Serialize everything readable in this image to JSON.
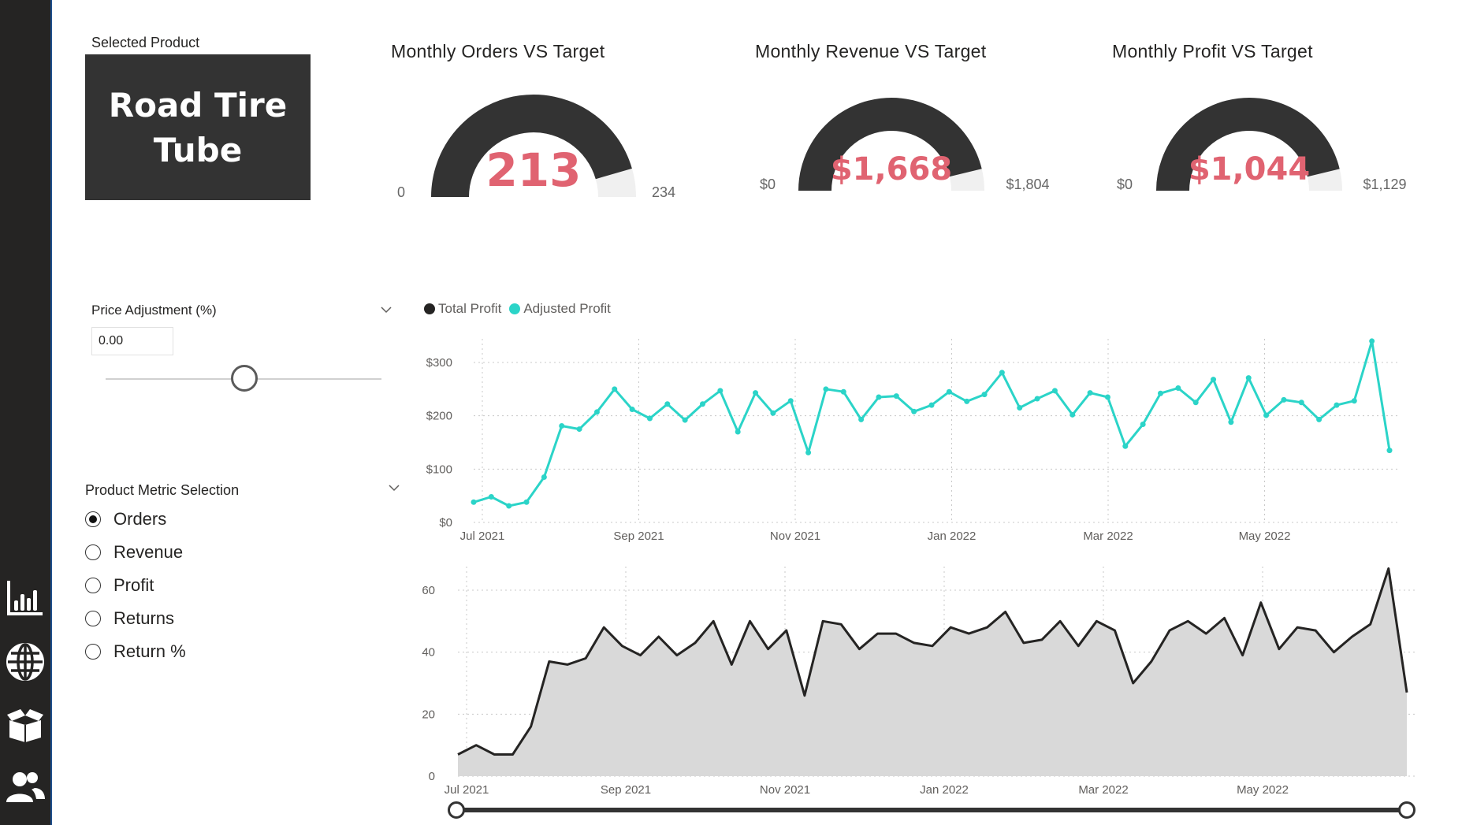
{
  "nav": {
    "items": [
      {
        "icon": "bar-chart-icon"
      },
      {
        "icon": "globe-icon"
      },
      {
        "icon": "open-box-icon"
      },
      {
        "icon": "users-icon"
      }
    ]
  },
  "product": {
    "label": "Selected Product",
    "name_line1": "Road Tire",
    "name_line2": "Tube"
  },
  "gauges": [
    {
      "title": "Monthly Orders VS Target",
      "value_text": "213",
      "min_text": "0",
      "max_text": "234",
      "fraction": 0.9103
    },
    {
      "title": "Monthly Revenue VS Target",
      "value_text": "$1,668",
      "min_text": "$0",
      "max_text": "$1,804",
      "fraction": 0.9246
    },
    {
      "title": "Monthly Profit VS Target",
      "value_text": "$1,044",
      "min_text": "$0",
      "max_text": "$1,129",
      "fraction": 0.9247
    }
  ],
  "colors": {
    "gauge_fill": "#333333",
    "gauge_empty": "#f0f0f0",
    "value": "#e06371",
    "adjusted": "#2bd4c8",
    "total": "#252423",
    "area": "#d9d9d9"
  },
  "price_adjustment": {
    "title": "Price Adjustment (%)",
    "value": "0.00",
    "slider_fraction": 0.5
  },
  "metric_selection": {
    "title": "Product Metric Selection",
    "options": [
      "Orders",
      "Revenue",
      "Profit",
      "Returns",
      "Return %"
    ],
    "selected": "Orders"
  },
  "legend": {
    "total": "Total Profit",
    "adjusted": "Adjusted Profit"
  },
  "chart_data": [
    {
      "type": "line",
      "x_tick_labels": [
        "Jul 2021",
        "Sep 2021",
        "Nov 2021",
        "Jan 2022",
        "Mar 2022",
        "May 2022"
      ],
      "y_tick_labels": [
        "$0",
        "$100",
        "$200",
        "$300"
      ],
      "ylim": [
        0,
        300
      ],
      "grid": true,
      "legend": "top-left",
      "series": [
        {
          "name": "Total Profit",
          "values": []
        },
        {
          "name": "Adjusted Profit",
          "values": [
            38,
            48,
            31,
            38,
            85,
            181,
            175,
            207,
            250,
            212,
            195,
            222,
            192,
            222,
            247,
            170,
            243,
            205,
            228,
            131,
            250,
            245,
            193,
            235,
            237,
            208,
            220,
            245,
            227,
            240,
            281,
            215,
            232,
            247,
            202,
            243,
            235,
            143,
            184,
            242,
            252,
            225,
            268,
            188,
            271,
            201,
            230,
            225,
            193,
            220,
            228,
            340,
            135
          ]
        }
      ]
    },
    {
      "type": "area",
      "x_tick_labels": [
        "Jul 2021",
        "Sep 2021",
        "Nov 2021",
        "Jan 2022",
        "Mar 2022",
        "May 2022"
      ],
      "y_tick_labels": [
        "0",
        "20",
        "40",
        "60"
      ],
      "ylim": [
        0,
        60
      ],
      "grid": true,
      "series": [
        {
          "name": "Orders",
          "values": [
            7,
            10,
            7,
            7,
            16,
            37,
            36,
            38,
            48,
            42,
            39,
            45,
            39,
            43,
            50,
            36,
            50,
            41,
            47,
            26,
            50,
            49,
            41,
            46,
            46,
            43,
            42,
            48,
            46,
            48,
            53,
            43,
            44,
            50,
            42,
            50,
            47,
            30,
            37,
            47,
            50,
            46,
            51,
            39,
            56,
            41,
            48,
            47,
            40,
            45,
            49,
            67,
            27
          ]
        }
      ]
    }
  ],
  "date_range": {
    "start_fraction": 0,
    "end_fraction": 1
  }
}
